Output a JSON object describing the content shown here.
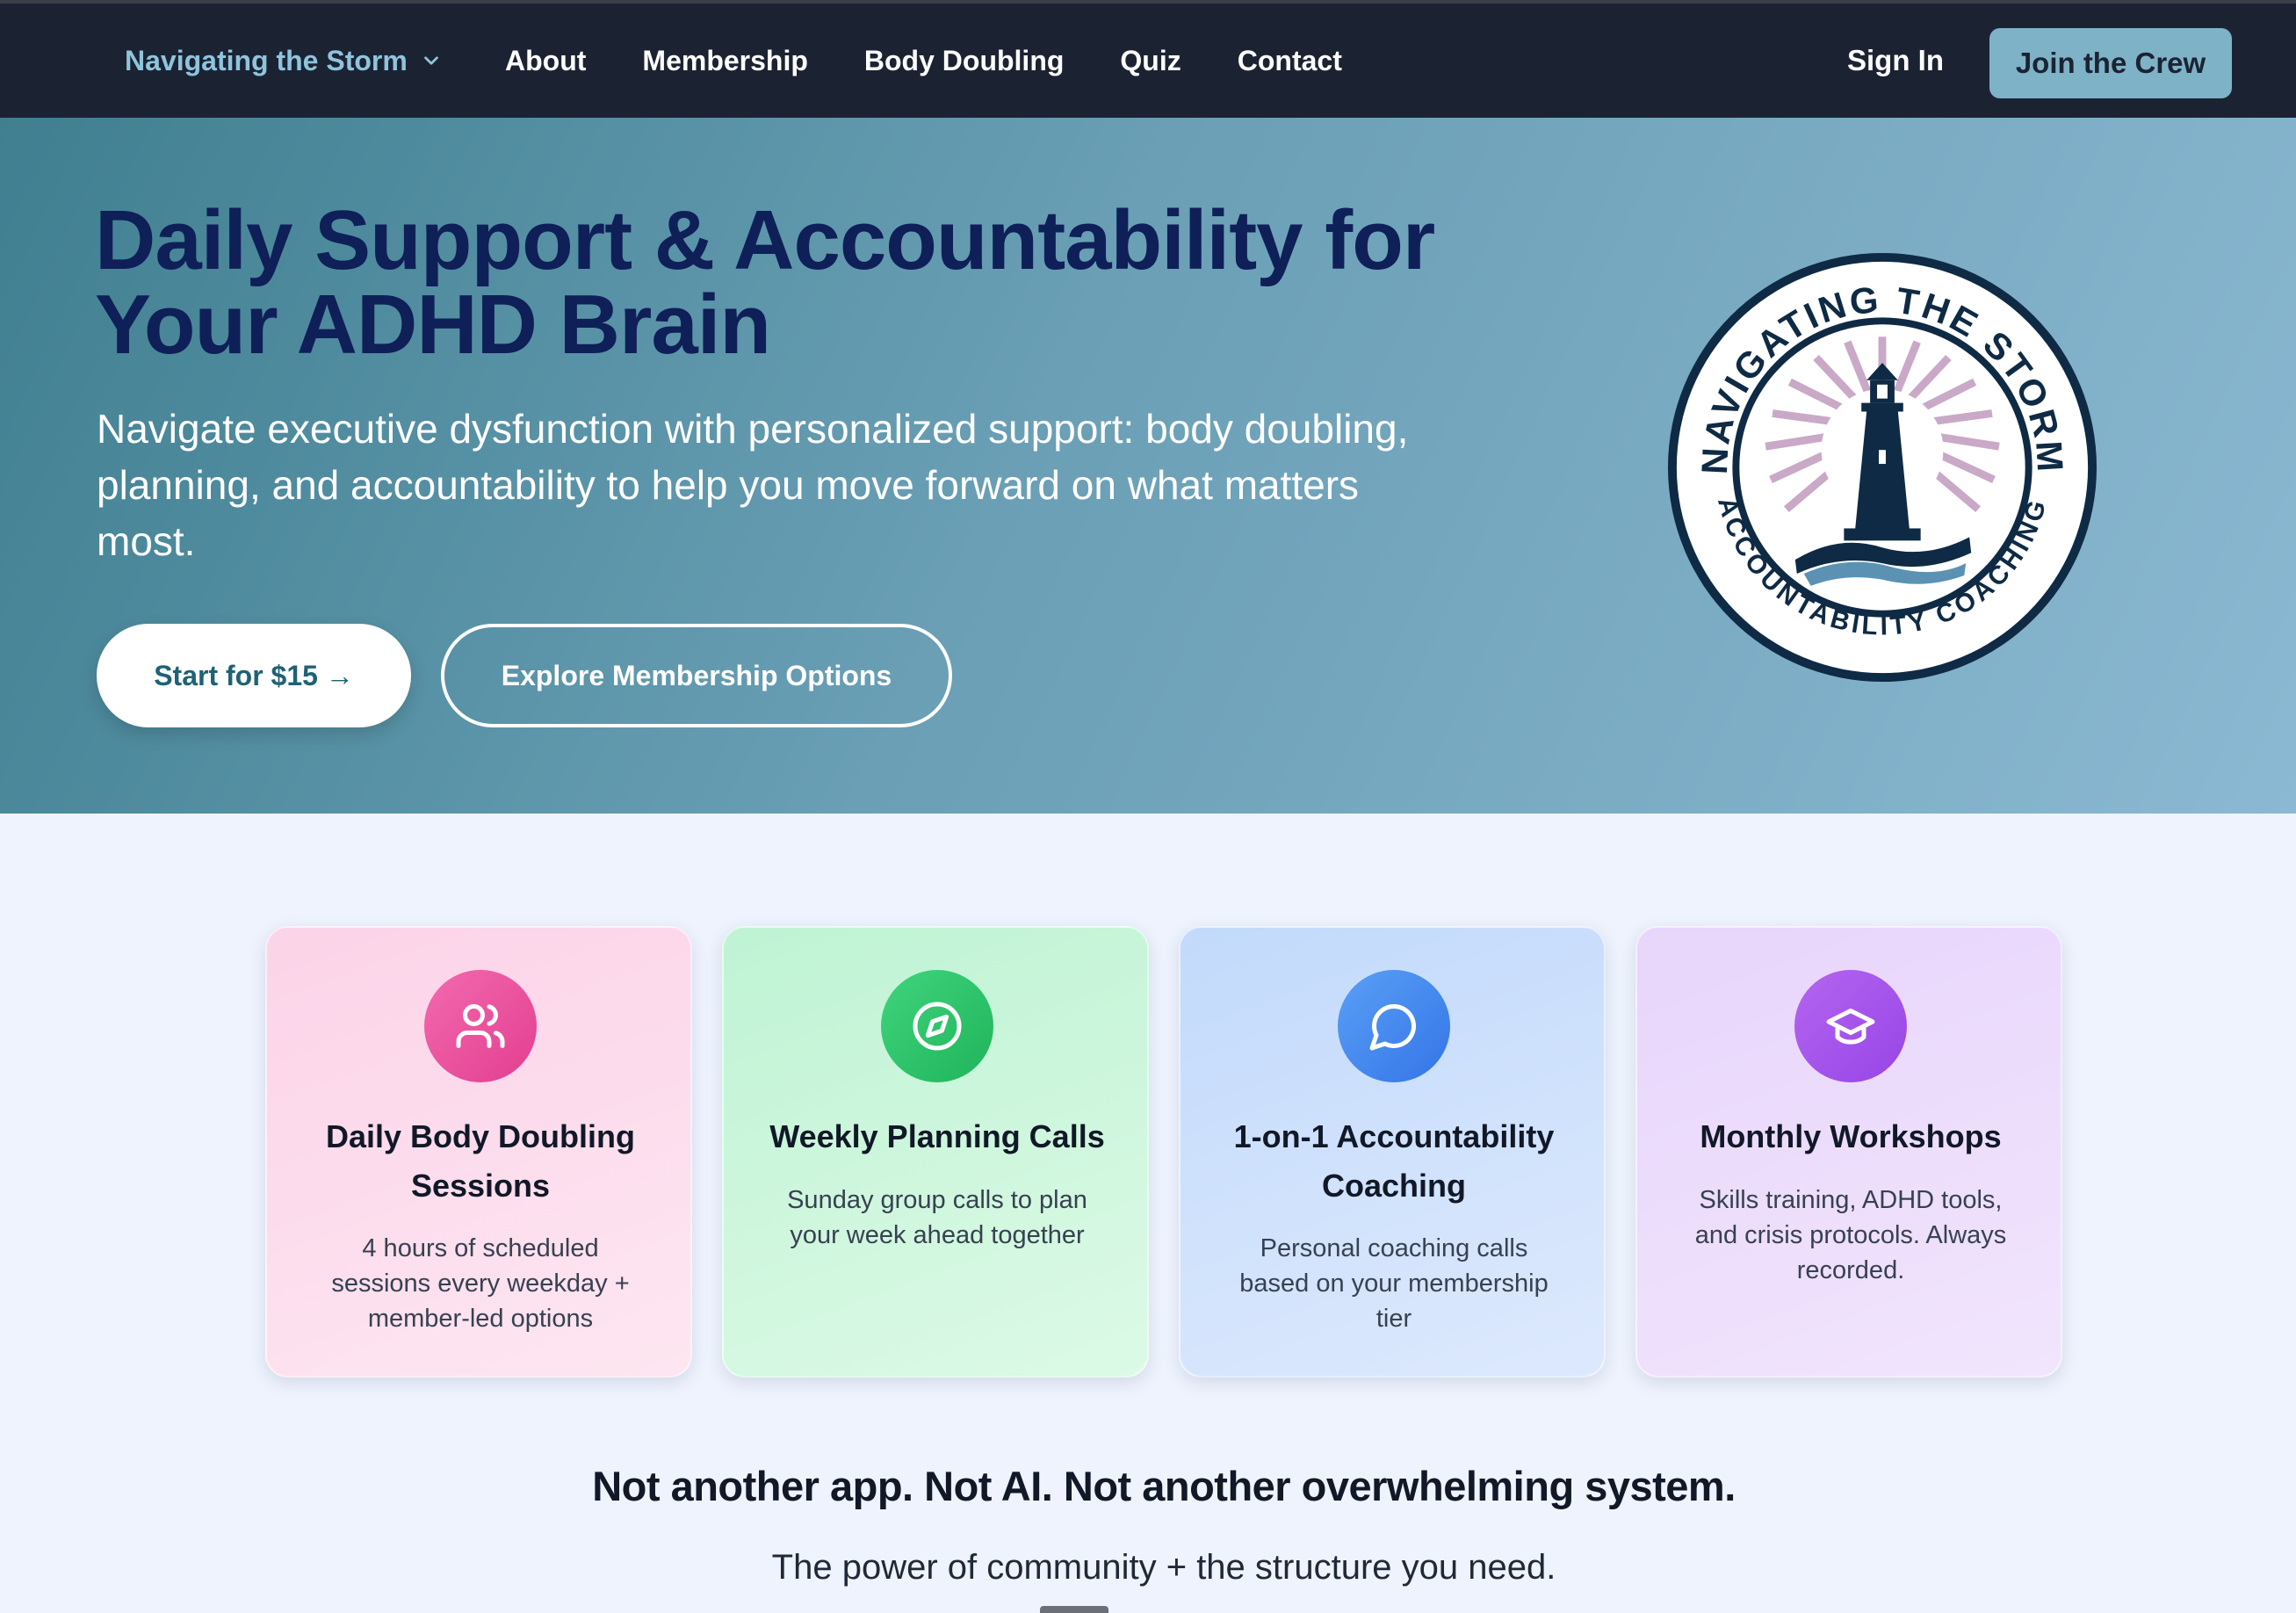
{
  "nav": {
    "brand": "Navigating the Storm",
    "links": [
      "About",
      "Membership",
      "Body Doubling",
      "Quiz",
      "Contact"
    ],
    "sign_in": "Sign In",
    "join": "Join the Crew"
  },
  "hero": {
    "title": "Daily Support & Accountability for Your ADHD Brain",
    "subtitle": "Navigate executive dysfunction with personalized support: body doubling, planning, and accountability to help you move forward on what matters most.",
    "primary_cta": "Start for $15 →",
    "secondary_cta": "Explore Membership Options",
    "badge": {
      "top_text": "NAVIGATING THE STORM",
      "bottom_text": "ACCOUNTABILITY COACHING"
    }
  },
  "features": [
    {
      "title": "Daily Body Doubling Sessions",
      "desc": "4 hours of scheduled sessions every weekday + member-led options",
      "icon": "users-icon",
      "color": "#e33e8f"
    },
    {
      "title": "Weekly Planning Calls",
      "desc": "Sunday group calls to plan your week ahead together",
      "icon": "compass-icon",
      "color": "#1fb45a"
    },
    {
      "title": "1-on-1 Accountability Coaching",
      "desc": "Personal coaching calls based on your membership tier",
      "icon": "chat-bubble-icon",
      "color": "#3474e8"
    },
    {
      "title": "Monthly Workshops",
      "desc": "Skills training, ADHD tools, and crisis protocols. Always recorded.",
      "icon": "graduation-cap-icon",
      "color": "#9645e6"
    }
  ],
  "tagline": "Not another app. Not AI. Not another overwhelming system.",
  "subline": "The power of community + the structure you need."
}
